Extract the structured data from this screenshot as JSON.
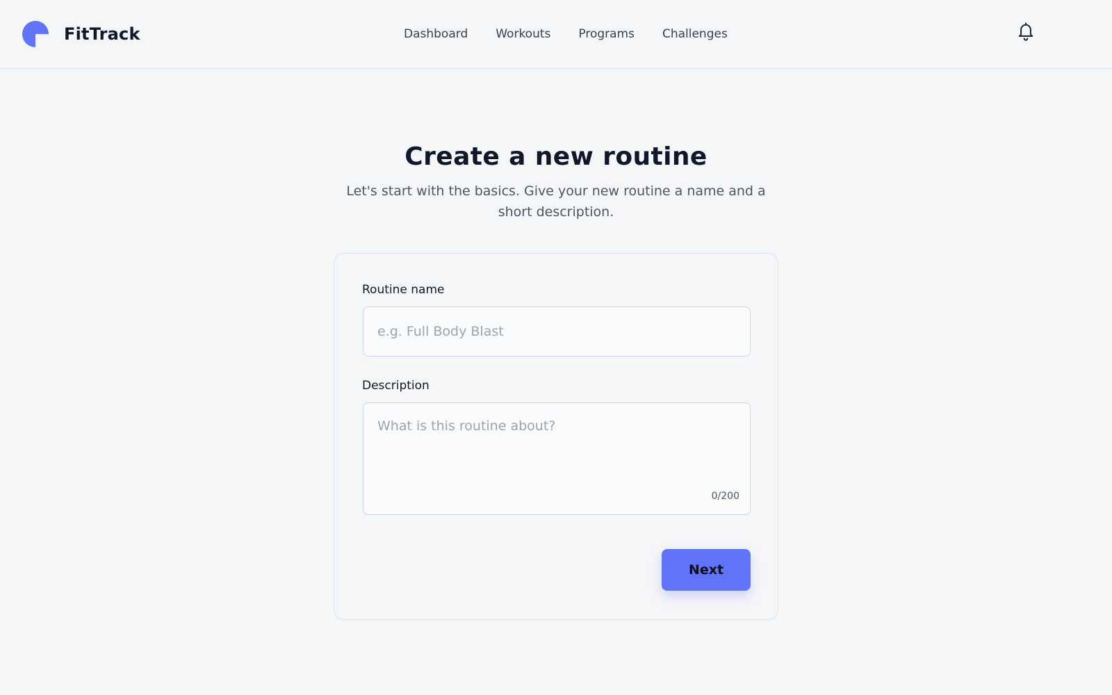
{
  "app": {
    "name": "FitTrack",
    "logo_icon": "logo-icon",
    "accent_color": "#6173f6"
  },
  "nav": {
    "items": [
      {
        "label": "Dashboard"
      },
      {
        "label": "Workouts"
      },
      {
        "label": "Programs"
      },
      {
        "label": "Challenges"
      }
    ],
    "notification_icon": "bell-icon"
  },
  "page": {
    "title": "Create a new routine",
    "subtitle": "Let's start with the basics. Give your new routine a name and a short description."
  },
  "form": {
    "name_label": "Routine name",
    "name_value": "",
    "name_placeholder": "e.g. Full Body Blast",
    "description_label": "Description",
    "description_value": "",
    "description_placeholder": "What is this routine about?",
    "char_count": "0/200",
    "next_label": "Next"
  }
}
